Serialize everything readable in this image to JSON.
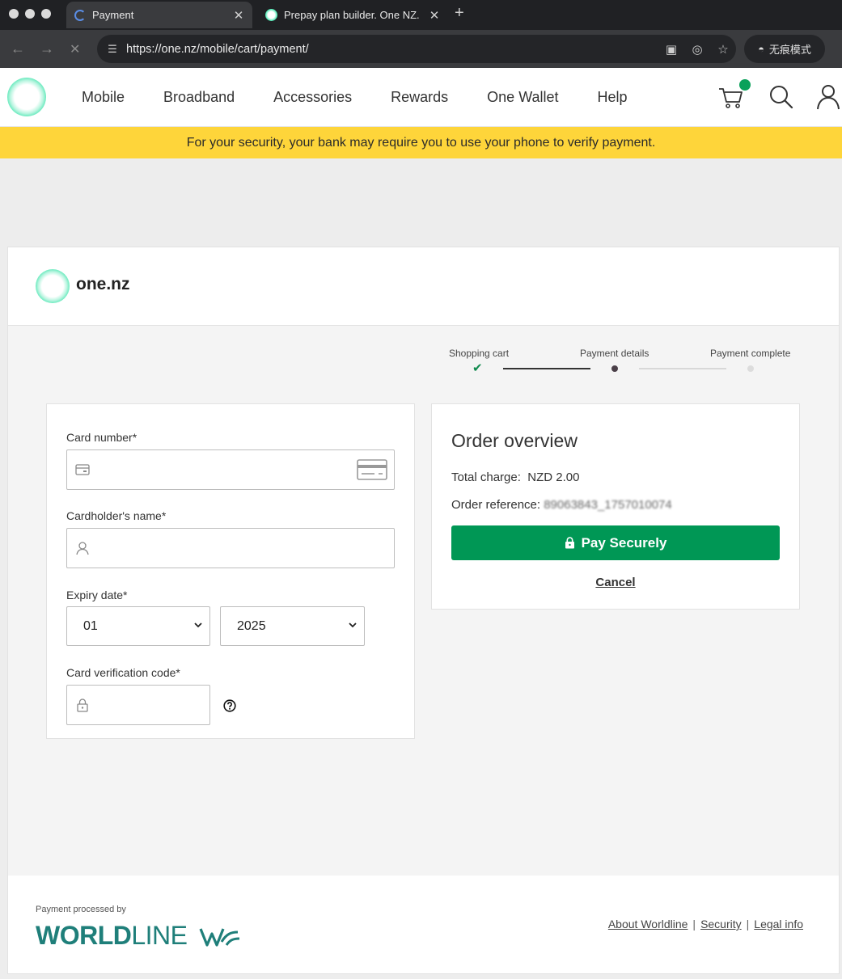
{
  "browser": {
    "tabs": [
      {
        "title": "Payment",
        "active": true
      },
      {
        "title": "Prepay plan builder. One NZ.",
        "active": false
      }
    ],
    "url": "https://one.nz/mobile/cart/payment/",
    "incognito_label": "无痕模式"
  },
  "header": {
    "nav": [
      "Mobile",
      "Broadband",
      "Accessories",
      "Rewards",
      "One Wallet",
      "Help"
    ],
    "cart_badge_color": "#0aa15a"
  },
  "banner": {
    "text": "For your security, your bank may require you to use your phone to verify payment.",
    "color": "#fed53a"
  },
  "card": {
    "brand": "one.nz",
    "steps": [
      {
        "label": "Shopping cart",
        "state": "complete"
      },
      {
        "label": "Payment details",
        "state": "current"
      },
      {
        "label": "Payment complete",
        "state": "pending"
      }
    ],
    "form": {
      "card_number_label": "Card number*",
      "cardholder_label": "Cardholder's name*",
      "expiry_label": "Expiry date*",
      "expiry_month": "01",
      "expiry_year": "2025",
      "cvc_label": "Card verification code*"
    },
    "order": {
      "title": "Order overview",
      "total_label": "Total charge:",
      "total_value": "NZD 2.00",
      "reference_label": "Order reference:",
      "reference_value": "89063843_1757010074",
      "pay_label": "Pay Securely",
      "cancel_label": "Cancel",
      "accent": "#009755"
    },
    "footer": {
      "processed_by": "Payment processed by",
      "brand_bold": "WORLD",
      "brand_thin": "LINE",
      "links": [
        "About Worldline",
        "Security",
        "Legal info"
      ]
    }
  }
}
